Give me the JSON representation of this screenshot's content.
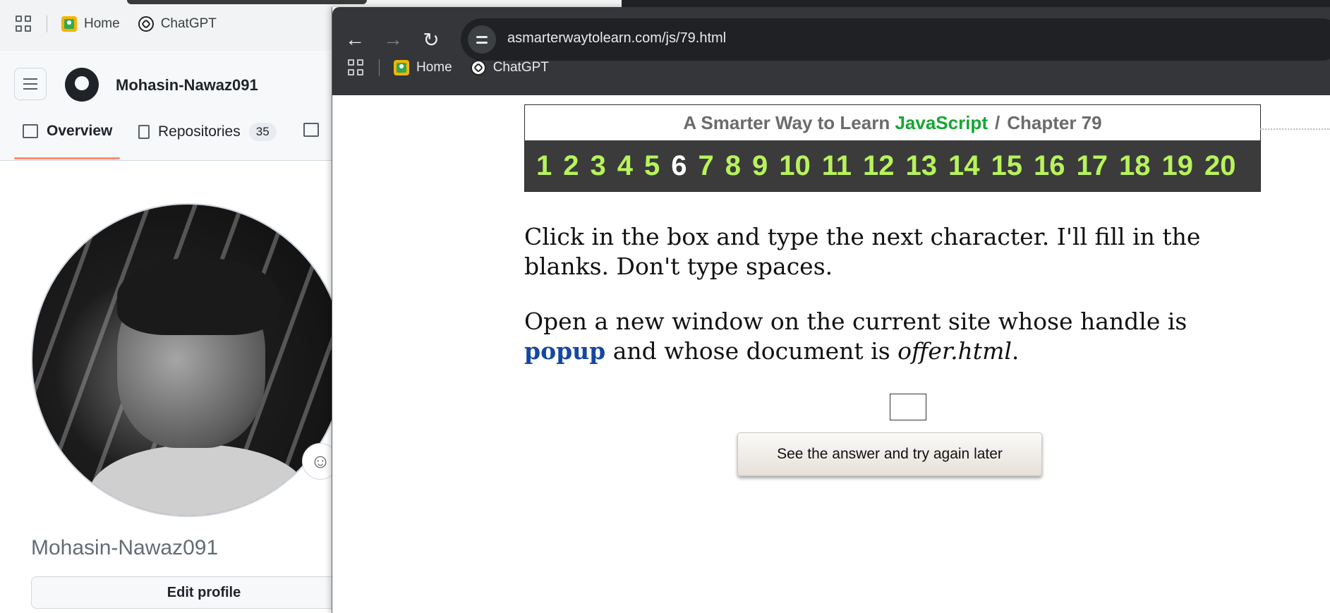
{
  "background_window": {
    "bookmarks": {
      "home": "Home",
      "chatgpt": "ChatGPT"
    },
    "github": {
      "username_header": "Mohasin-Nawaz091",
      "tabs": [
        {
          "label": "Overview"
        },
        {
          "label": "Repositories",
          "count": "35"
        }
      ],
      "profile_name": "Mohasin-Nawaz091",
      "edit_profile_label": "Edit profile",
      "emoji_icon": "☺"
    }
  },
  "browser": {
    "url": "asmarterwaytolearn.com/js/79.html",
    "bookmarks": {
      "home": "Home",
      "chatgpt": "ChatGPT"
    },
    "icons": {
      "back": "←",
      "forward": "→",
      "reload": "↻"
    }
  },
  "lesson": {
    "title_prefix": "A Smarter Way to Learn",
    "title_highlight": "JavaScript",
    "title_sep": "/",
    "chapter_label": "Chapter 79",
    "chapter_links": [
      "1",
      "2",
      "3",
      "4",
      "5",
      "6",
      "7",
      "8",
      "9",
      "10",
      "11",
      "12",
      "13",
      "14",
      "15",
      "16",
      "17",
      "18",
      "19",
      "20"
    ],
    "current_link": "6",
    "instruction": "Click in the box and type the next character. I'll fill in the blanks. Don't type spaces.",
    "task_part1": "Open a new window on the current site whose handle is",
    "task_keyword": "popup",
    "task_part2": "and whose document is",
    "task_document": "offer.html",
    "task_end": ".",
    "answer_value": "",
    "answer_button_label": "See the answer and try again later"
  },
  "colors": {
    "chapter_link": "#b7f35c",
    "chapter_link_current": "#ffffff",
    "javascript_green": "#17a534",
    "keyword_blue": "#1447a3",
    "browser_toolbar": "#35363a"
  }
}
